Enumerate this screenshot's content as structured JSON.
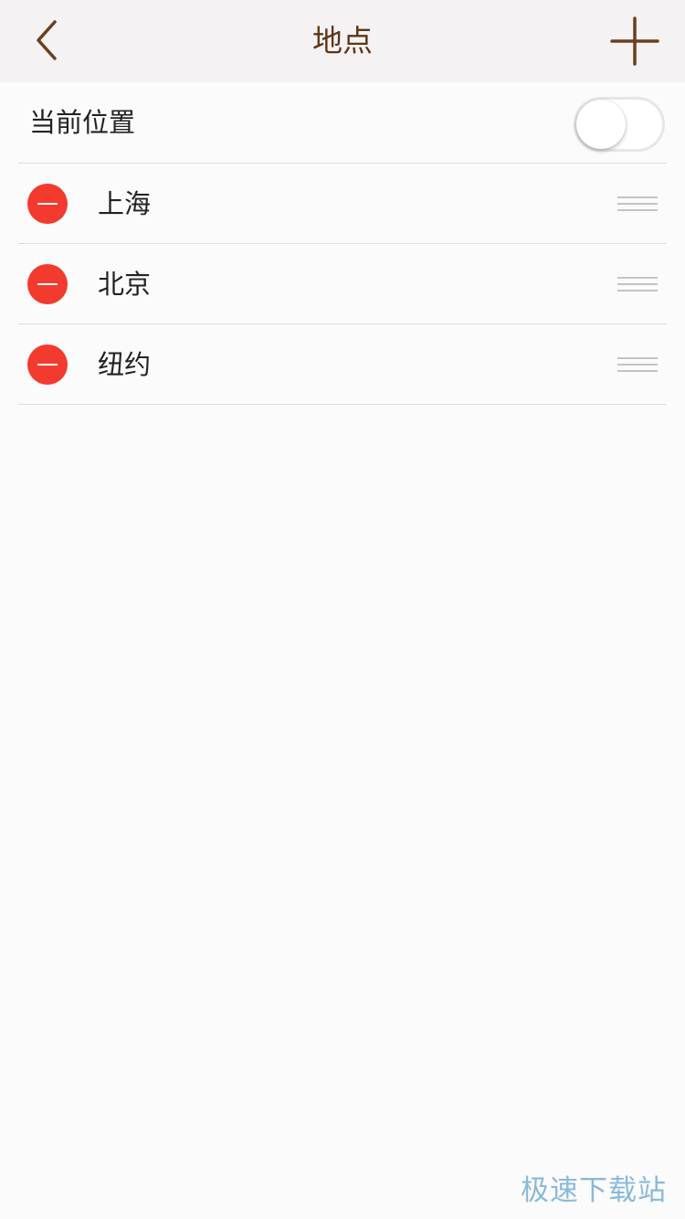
{
  "nav": {
    "title": "地点",
    "back_icon": "chevron-left-icon",
    "add_icon": "plus-icon",
    "accent_color": "#6a3f1e"
  },
  "current_location": {
    "label": "当前位置",
    "toggle_on": false
  },
  "locations": [
    {
      "name": "上海"
    },
    {
      "name": "北京"
    },
    {
      "name": "纽约"
    }
  ],
  "colors": {
    "delete": "#f33a2f",
    "divider": "#dcdcdc",
    "handle": "#c4c4c4"
  },
  "watermark": "极速下载站"
}
